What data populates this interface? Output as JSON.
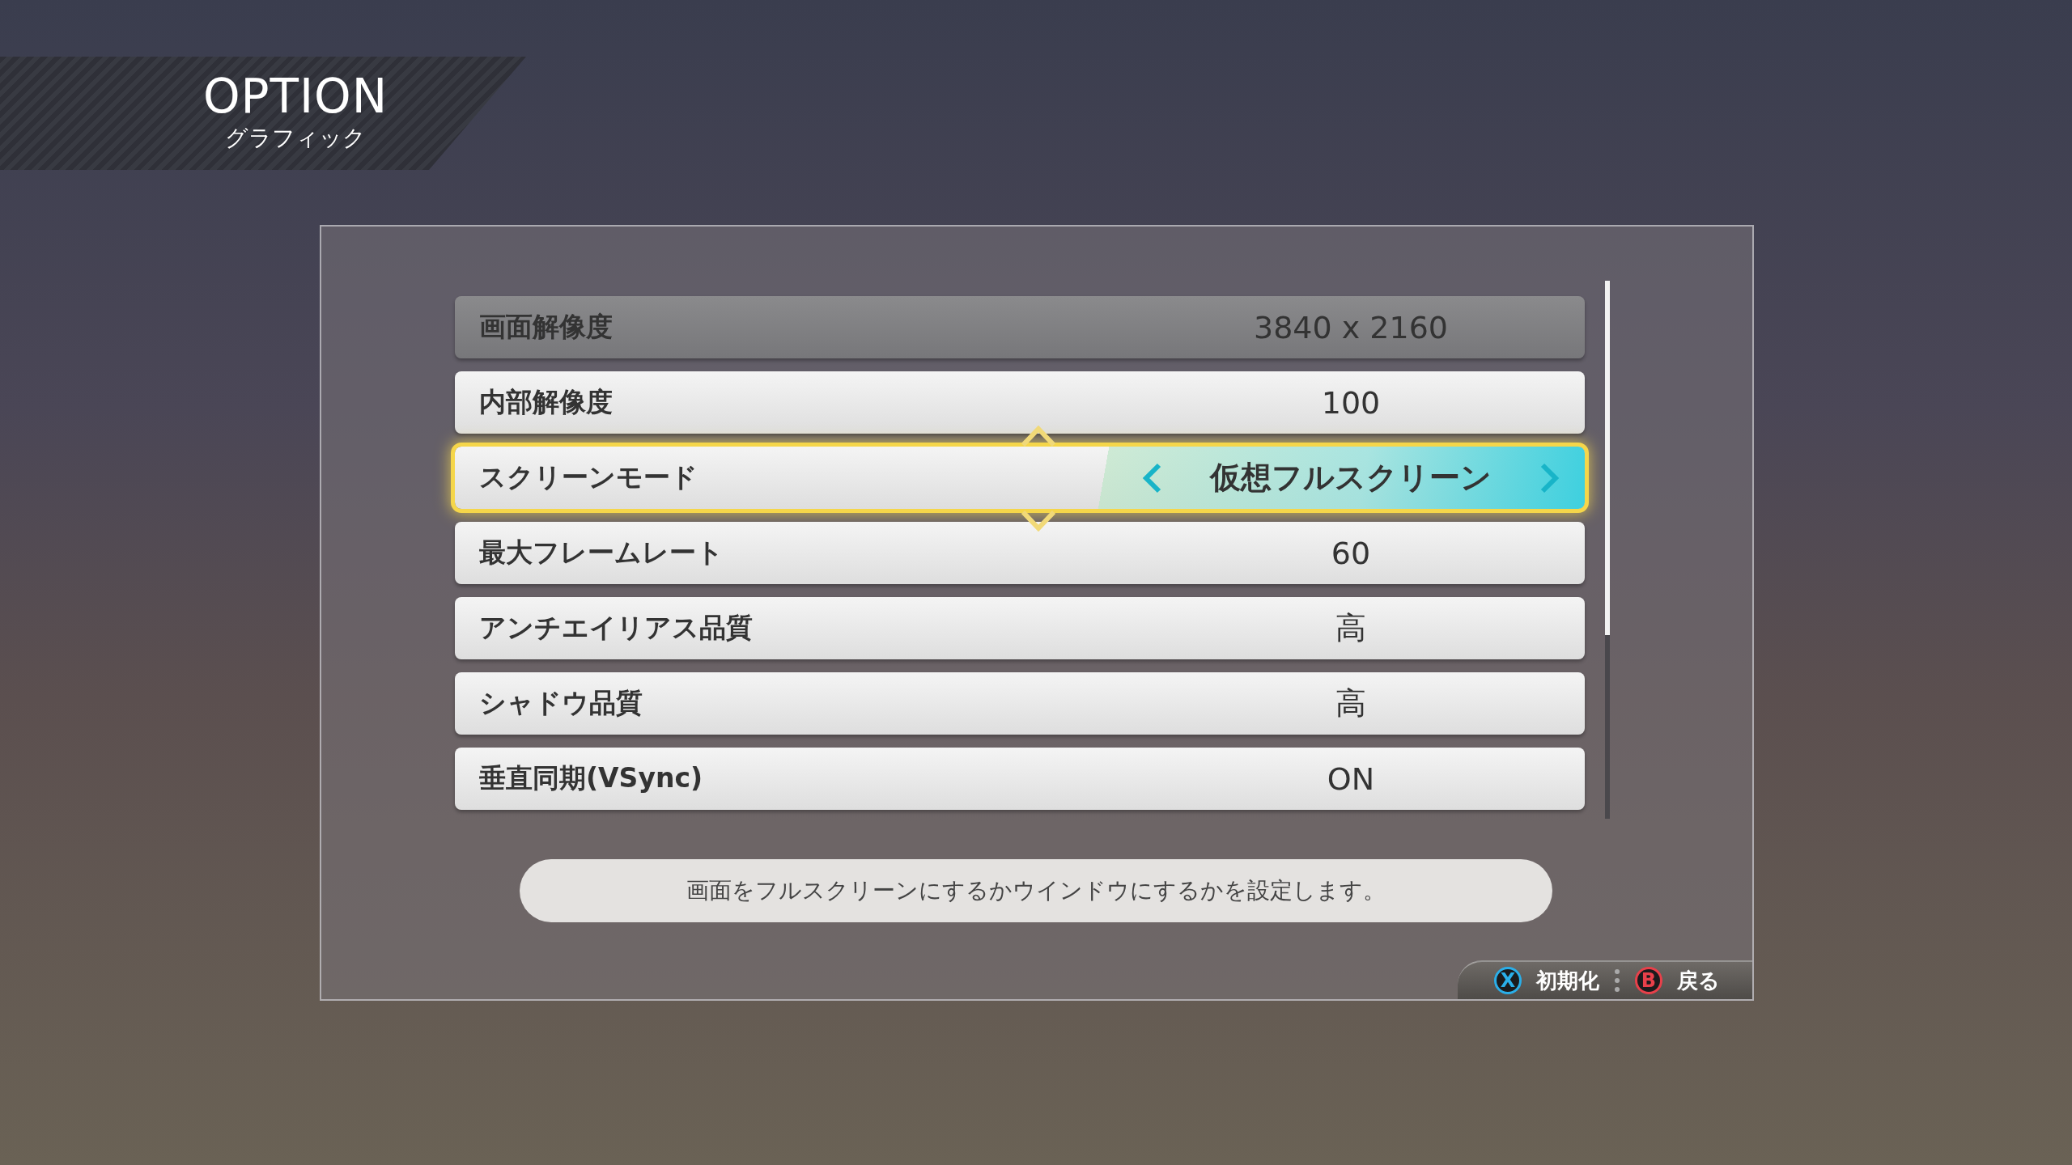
{
  "header": {
    "title": "OPTION",
    "subtitle": "グラフィック"
  },
  "settings": [
    {
      "label": "画面解像度",
      "value": "3840 x 2160",
      "selected": false,
      "disabled": true
    },
    {
      "label": "内部解像度",
      "value": "100",
      "selected": false,
      "disabled": false
    },
    {
      "label": "スクリーンモード",
      "value": "仮想フルスクリーン",
      "selected": true,
      "disabled": false
    },
    {
      "label": "最大フレームレート",
      "value": "60",
      "selected": false,
      "disabled": false
    },
    {
      "label": "アンチエイリアス品質",
      "value": "高",
      "selected": false,
      "disabled": false
    },
    {
      "label": "シャドウ品質",
      "value": "高",
      "selected": false,
      "disabled": false
    },
    {
      "label": "垂直同期(VSync)",
      "value": "ON",
      "selected": false,
      "disabled": false
    }
  ],
  "description": "画面をフルスクリーンにするかウインドウにするかを設定します。",
  "footer_buttons": [
    {
      "key": "X",
      "label": "初期化",
      "color": "#2aaee8"
    },
    {
      "key": "B",
      "label": "戻る",
      "color": "#e8404a"
    }
  ]
}
